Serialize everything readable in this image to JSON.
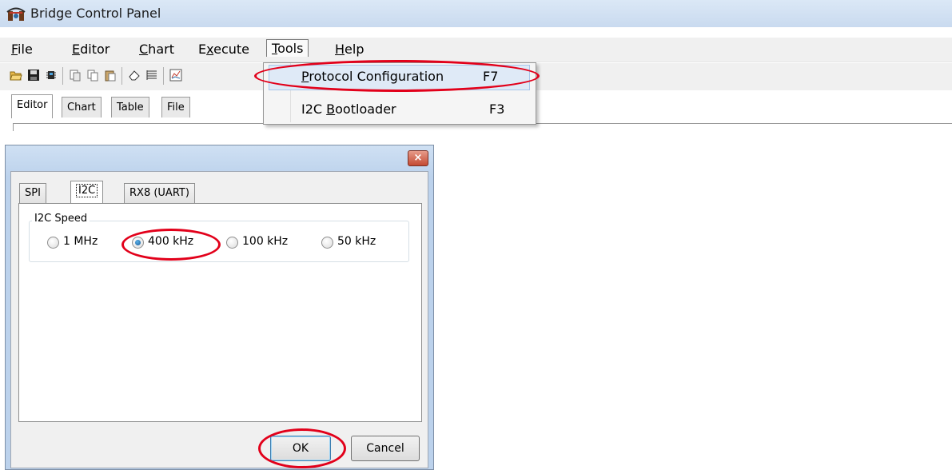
{
  "window": {
    "title": "Bridge Control Panel"
  },
  "menubar": {
    "items": [
      {
        "label": "File",
        "mnemonic": "F",
        "rest": "ile"
      },
      {
        "label": "Editor",
        "mnemonic": "E",
        "rest": "ditor"
      },
      {
        "label": "Chart",
        "mnemonic": "C",
        "rest": "hart"
      },
      {
        "label": "Execute",
        "pre": "E",
        "mnemonic": "x",
        "rest": "ecute"
      },
      {
        "label": "Tools",
        "mnemonic": "T",
        "rest": "ools"
      },
      {
        "label": "Help",
        "mnemonic": "H",
        "rest": "elp"
      }
    ]
  },
  "tools_menu": {
    "items": [
      {
        "pre": "",
        "mnemonic": "P",
        "rest": "rotocol Configuration",
        "shortcut": "F7"
      },
      {
        "pre": "I2C ",
        "mnemonic": "B",
        "rest": "ootloader",
        "shortcut": "F3"
      }
    ]
  },
  "editor_tabs": [
    "Editor",
    "Chart",
    "Table",
    "File"
  ],
  "dialog": {
    "close_glyph": "×",
    "tabs": [
      "SPI",
      "I2C",
      "RX8 (UART)"
    ],
    "group_label": "I2C Speed",
    "speeds": [
      "1 MHz",
      "400 kHz",
      "100 kHz",
      "50 kHz"
    ],
    "selected_speed": "400 kHz",
    "ok_label": "OK",
    "cancel_label": "Cancel"
  },
  "highlight_color": "#e2001a"
}
